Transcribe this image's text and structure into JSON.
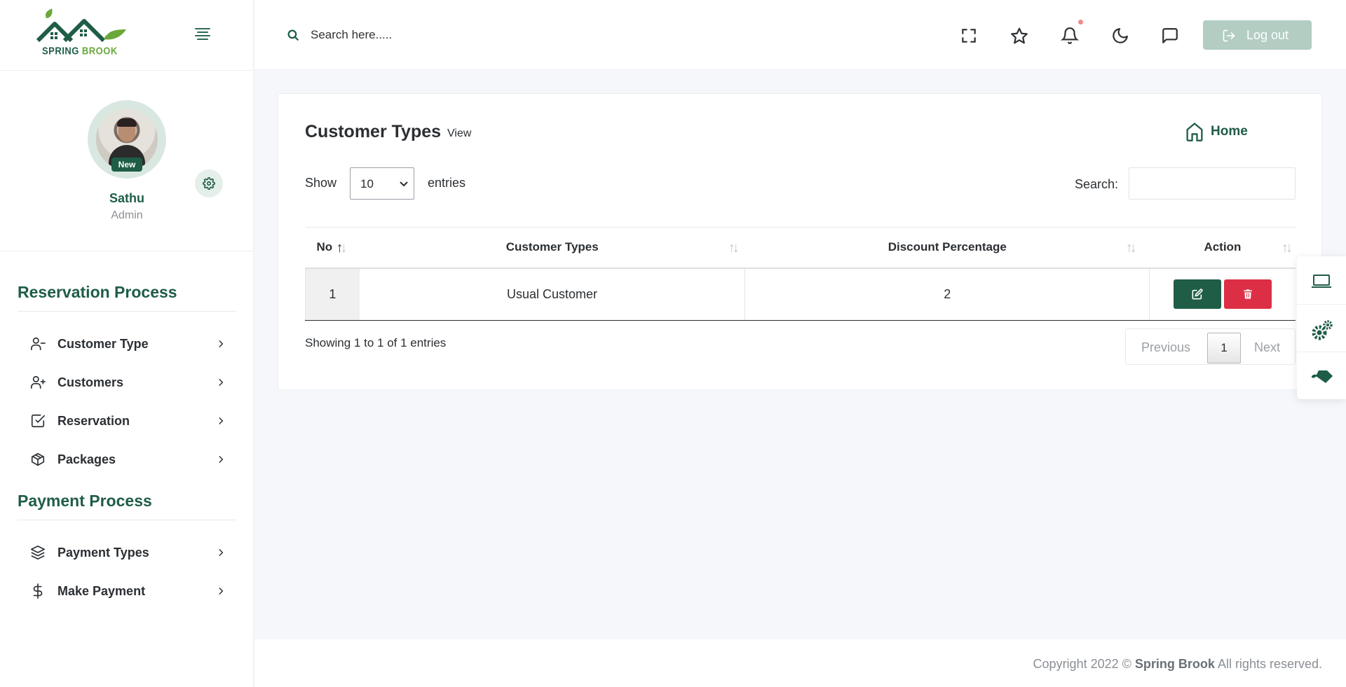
{
  "brand": {
    "name_part1": "SPRING",
    "name_part2": "BROOK"
  },
  "profile": {
    "name": "Sathu",
    "role": "Admin",
    "badge": "New"
  },
  "sidebar": {
    "sections": [
      {
        "title": "Reservation Process",
        "items": [
          {
            "label": "Customer Type",
            "icon": "user-minus-icon"
          },
          {
            "label": "Customers",
            "icon": "user-plus-icon"
          },
          {
            "label": "Reservation",
            "icon": "check-square-icon"
          },
          {
            "label": "Packages",
            "icon": "package-icon"
          }
        ]
      },
      {
        "title": "Payment Process",
        "items": [
          {
            "label": "Payment Types",
            "icon": "layers-icon"
          },
          {
            "label": "Make Payment",
            "icon": "dollar-icon"
          }
        ]
      }
    ]
  },
  "topbar": {
    "search_placeholder": "Search here.....",
    "logout_label": "Log out"
  },
  "page": {
    "title": "Customer Types",
    "subtitle": "View",
    "home_label": "Home"
  },
  "table": {
    "show_label": "Show",
    "entries_value": "10",
    "entries_label": "entries",
    "search_label": "Search:",
    "columns": [
      "No",
      "Customer Types",
      "Discount Percentage",
      "Action"
    ],
    "rows": [
      {
        "no": "1",
        "type": "Usual Customer",
        "discount": "2"
      }
    ],
    "info": "Showing 1 to 1 of 1 entries",
    "pager": {
      "prev": "Previous",
      "current": "1",
      "next": "Next"
    }
  },
  "footer": {
    "prefix": "Copyright 2022 ©",
    "brand": "Spring Brook",
    "suffix": "All rights reserved."
  },
  "colors": {
    "primary": "#1f5d46",
    "danger": "#dc2f45",
    "accent_green": "#6aa83a"
  }
}
